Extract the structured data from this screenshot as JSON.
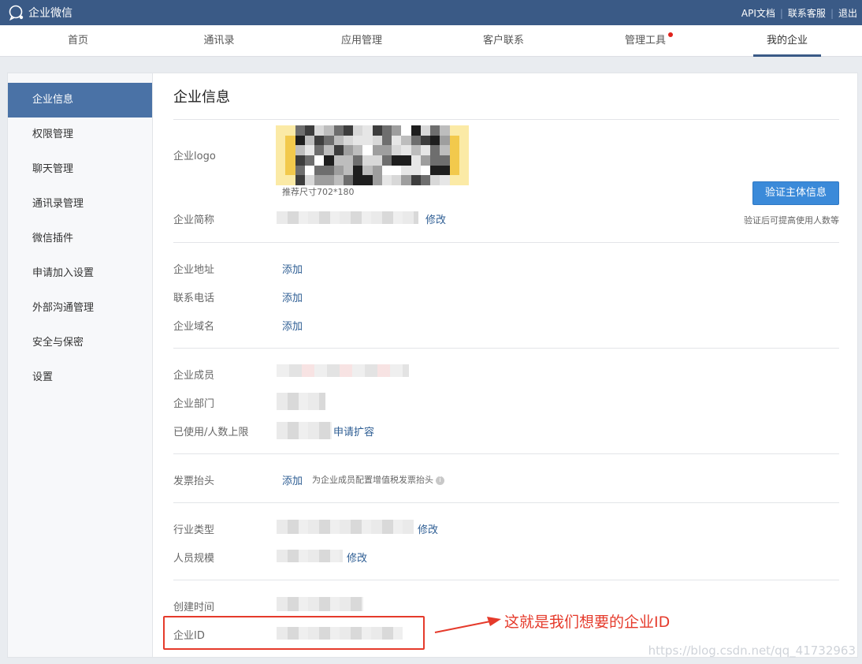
{
  "topbar": {
    "brand": "企业微信",
    "links": [
      "API文档",
      "联系客服",
      "退出"
    ],
    "bg_color": "#3a5a86"
  },
  "nav": {
    "items": [
      "首页",
      "通讯录",
      "应用管理",
      "客户联系",
      "管理工具",
      "我的企业"
    ],
    "active": "我的企业",
    "badge_on": "管理工具"
  },
  "sidebar": {
    "items": [
      "企业信息",
      "权限管理",
      "聊天管理",
      "通讯录管理",
      "微信插件",
      "申请加入设置",
      "外部沟通管理",
      "安全与保密",
      "设置"
    ],
    "active": "企业信息"
  },
  "main": {
    "title": "企业信息",
    "logo": {
      "label": "企业logo",
      "size_hint": "推荐尺寸702*180"
    },
    "verify_button": "验证主体信息",
    "verify_note": "验证后可提高使用人数等",
    "short_name": {
      "label": "企业简称",
      "action": "修改"
    },
    "address": {
      "label": "企业地址",
      "action": "添加"
    },
    "phone": {
      "label": "联系电话",
      "action": "添加"
    },
    "domain": {
      "label": "企业域名",
      "action": "添加"
    },
    "members": {
      "label": "企业成员"
    },
    "departments": {
      "label": "企业部门"
    },
    "usage": {
      "label": "已使用/人数上限",
      "action": "申请扩容"
    },
    "invoice": {
      "label": "发票抬头",
      "action": "添加",
      "hint": "为企业成员配置增值税发票抬头"
    },
    "industry": {
      "label": "行业类型",
      "action": "修改"
    },
    "scale": {
      "label": "人员规模",
      "action": "修改"
    },
    "created": {
      "label": "创建时间"
    },
    "corp_id": {
      "label": "企业ID"
    }
  },
  "annotation": {
    "text": "这就是我们想要的企业ID",
    "color": "#e53a2b"
  },
  "watermark": "https://blog.csdn.net/qq_41732963"
}
